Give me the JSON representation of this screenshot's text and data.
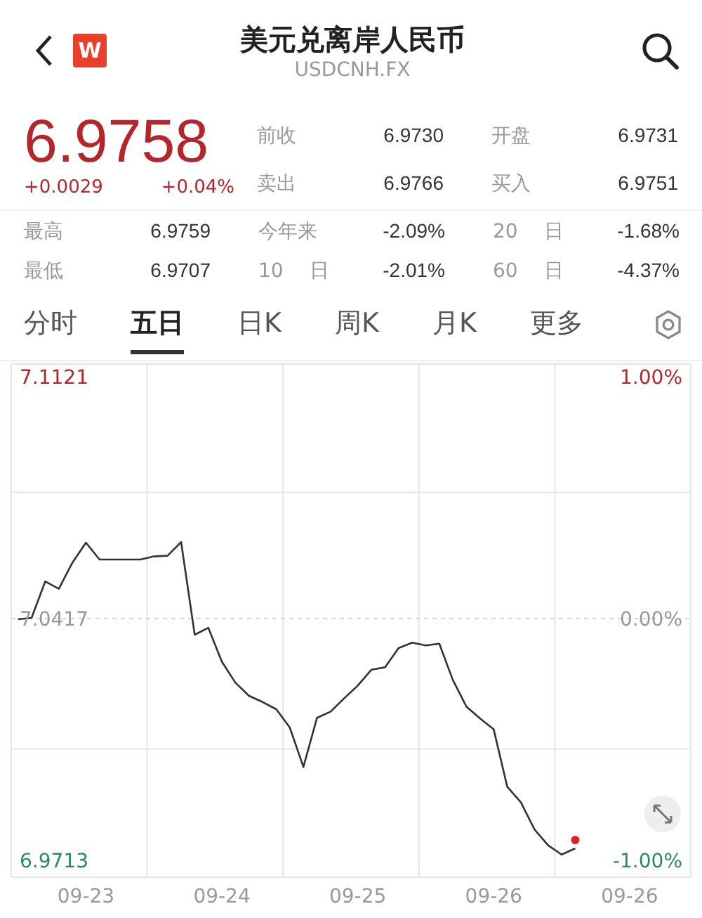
{
  "header": {
    "logo_text": "W",
    "title": "美元兑离岸人民币",
    "subtitle": "USDCNH.FX"
  },
  "quote": {
    "price": "6.9758",
    "change": "+0.0029",
    "change_pct": "+0.04%",
    "up": true,
    "fields": [
      {
        "label": "前收",
        "value": "6.9730"
      },
      {
        "label": "开盘",
        "value": "6.9731"
      },
      {
        "label": "卖出",
        "value": "6.9766"
      },
      {
        "label": "买入",
        "value": "6.9751"
      }
    ]
  },
  "stats": [
    {
      "label": "最高",
      "value": "6.9759"
    },
    {
      "label": "今年来",
      "value": "-2.09%"
    },
    {
      "label": "20 日",
      "value": "-1.68%"
    },
    {
      "label": "最低",
      "value": "6.9707"
    },
    {
      "label": "10 日",
      "value": "-2.01%"
    },
    {
      "label": "60 日",
      "value": "-4.37%"
    }
  ],
  "tabs": [
    {
      "label": "分时",
      "selected": false
    },
    {
      "label": "五日",
      "selected": true
    },
    {
      "label": "日K",
      "selected": false
    },
    {
      "label": "周K",
      "selected": false
    },
    {
      "label": "月K",
      "selected": false
    },
    {
      "label": "更多",
      "selected": false
    }
  ],
  "chart": {
    "percent_labels": [
      {
        "label": "1.00%",
        "color": "#b3262b"
      },
      {
        "label": "0.00%",
        "color": "#999999"
      },
      {
        "label": "-1.00%",
        "color": "#2e8b57"
      }
    ],
    "chart_data": {
      "type": "line",
      "categories": [
        null,
        null,
        null,
        null,
        null,
        "09-23",
        null,
        null,
        null,
        null,
        null,
        null,
        null,
        null,
        null,
        "09-24",
        null,
        null,
        null,
        null,
        null,
        null,
        null,
        null,
        null,
        "09-25",
        null,
        null,
        null,
        null,
        null,
        null,
        null,
        null,
        null,
        "09-26",
        null,
        null,
        null,
        null,
        null,
        null,
        null,
        null,
        null,
        "09-26",
        null,
        null,
        null,
        null
      ],
      "series": [
        {
          "color": "#333333",
          "values": [
            7.0415,
            7.0419,
            7.0525,
            7.0504,
            7.058,
            7.0638,
            7.0589,
            7.0589,
            7.0589,
            7.0589,
            7.0598,
            7.06,
            7.064,
            7.037,
            7.039,
            7.0292,
            7.023,
            7.0192,
            7.0174,
            7.0153,
            7.01,
            6.9985,
            7.0128,
            7.0146,
            7.0185,
            7.0222,
            7.0268,
            7.0275,
            7.0331,
            7.0347,
            7.0339,
            7.0344,
            7.0238,
            7.016,
            7.0126,
            7.0095,
            6.9927,
            6.9882,
            6.9803,
            6.9757,
            6.973,
            6.9748,
            null,
            null,
            null,
            null,
            null,
            null,
            null,
            null
          ]
        }
      ],
      "ylim": [
        6.9664,
        7.1158
      ],
      "ref_lines": [
        {
          "value": 7.0417,
          "axis": "y"
        }
      ],
      "yticks": [
        {
          "value": 6.9713,
          "label": "6.9713"
        },
        {
          "value": 7.0417,
          "label": "7.0417"
        },
        {
          "value": 7.1121,
          "label": "7.1121"
        }
      ]
    }
  }
}
